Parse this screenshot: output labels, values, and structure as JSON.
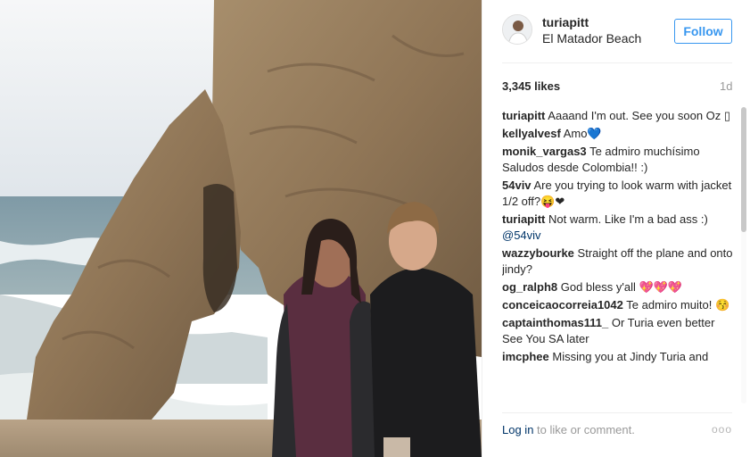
{
  "post": {
    "username": "turiapitt",
    "location": "El Matador Beach",
    "follow_label": "Follow",
    "likes": "3,345 likes",
    "age": "1d"
  },
  "comments": [
    {
      "user": "turiapitt",
      "text": "Aaaand I'm out. See you soon Oz ▯"
    },
    {
      "user": "kellyalvesf",
      "text": "Amo💙"
    },
    {
      "user": "monik_vargas3",
      "text": "Te admiro muchísimo Saludos desde Colombia!! :)"
    },
    {
      "user": "54viv",
      "text": "Are you trying to look warm with jacket 1/2 off?😝❤"
    },
    {
      "user": "turiapitt",
      "text": "Not warm. Like I'm a bad ass :) ",
      "mention": "@54viv"
    },
    {
      "user": "wazzybourke",
      "text": "Straight off the plane and onto jindy?"
    },
    {
      "user": "og_ralph8",
      "text": "God bless y'all 💖💖💖"
    },
    {
      "user": "conceicaocorreia1042",
      "text": "Te admiro muito! 😚"
    },
    {
      "user": "captainthomas111_",
      "text": "Or Turia even better See You SA later"
    },
    {
      "user": "imcphee",
      "text": "Missing you at Jindy Turia and"
    }
  ],
  "footer": {
    "login_label": "Log in",
    "suffix": " to like or comment.",
    "more_label": "ooo"
  },
  "icons": {
    "avatar": "avatar",
    "more": "more-options-icon"
  },
  "colors": {
    "accent": "#3897f0",
    "link": "#003569",
    "muted": "#999999"
  }
}
